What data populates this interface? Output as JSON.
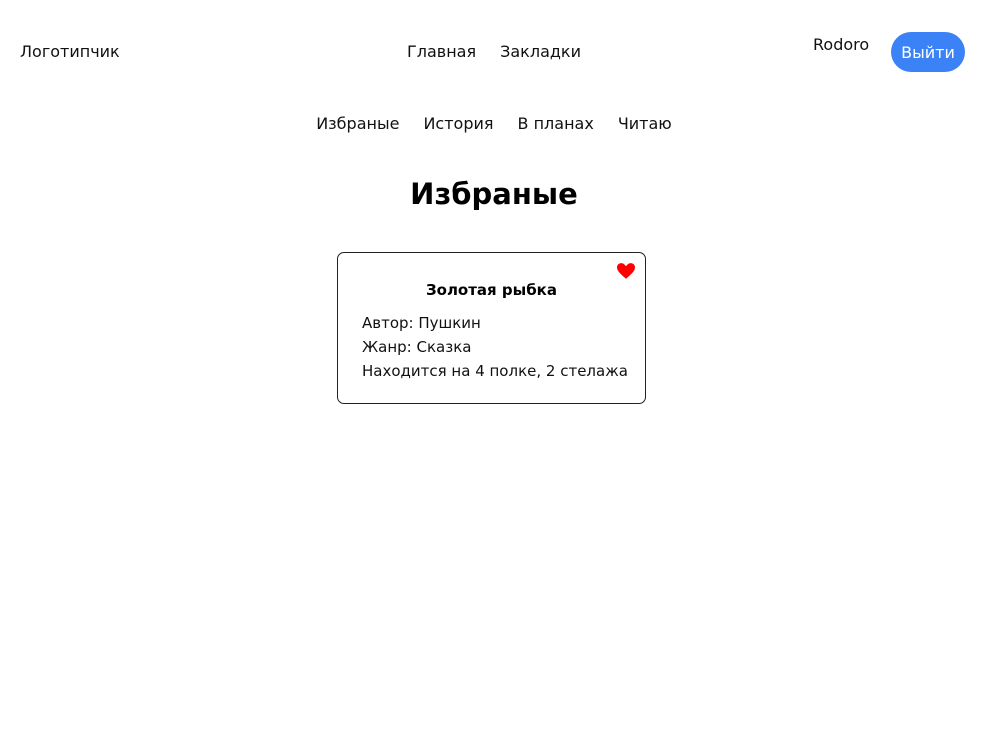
{
  "header": {
    "logo": "Логотипчик",
    "nav": [
      {
        "label": "Главная"
      },
      {
        "label": "Закладки"
      }
    ],
    "username": "Rodoro",
    "logout_label": "Выйти"
  },
  "sub_nav": [
    {
      "label": "Избраные"
    },
    {
      "label": "История"
    },
    {
      "label": "В планах"
    },
    {
      "label": "Читаю"
    }
  ],
  "page_title": "Избраные",
  "books": [
    {
      "title": "Золотая рыбка",
      "author": "Автор: Пушкин",
      "genre": "Жанр: Сказка",
      "location": "Находится на 4 полке, 2 стелажа",
      "favorite_icon": "heart-icon",
      "favorite_color": "#ff0000"
    }
  ],
  "colors": {
    "accent": "#3b82f6",
    "favorite": "#ff0000"
  }
}
